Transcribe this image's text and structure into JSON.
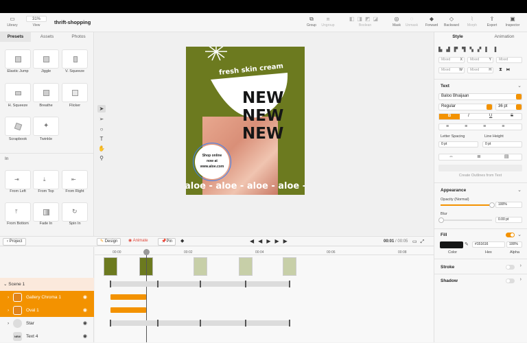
{
  "toolbar": {
    "library": "Library",
    "zoom": "31%",
    "view": "View",
    "doc_title": "thrift-shopping",
    "group": "Group",
    "ungroup": "Ungroup",
    "boolean": "Boolean",
    "mask": "Mask",
    "unmask": "Unmask",
    "forward": "Forward",
    "backward": "Backward",
    "morph": "Morph",
    "export": "Export",
    "inspector": "Inspector"
  },
  "left_tabs": [
    "Presets",
    "Assets",
    "Photos"
  ],
  "presets": [
    "Elastic Jump",
    "Jiggle",
    "V. Squeeze",
    "H. Squeeze",
    "Breathe",
    "Flicker",
    "Scrapbook",
    "Twinkle"
  ],
  "in_section": "In",
  "in_presets": [
    "From Left",
    "From Top",
    "From Right",
    "From Bottom",
    "Fade In",
    "Spin In"
  ],
  "project_button": "Project",
  "artboard": {
    "headline": "fresh skin cream",
    "new_lines": [
      "NEW",
      "NEW",
      "NEW"
    ],
    "badge_lines": [
      "Shop online",
      "now at",
      "www.aloe.com"
    ],
    "marquee": "aloe - aloe - aloe - aloe -al"
  },
  "timeline": {
    "design": "Design",
    "animate": "Animate",
    "pin": "Pin",
    "time_current": "00:01",
    "time_total": "/ 00:05",
    "ticks": [
      "00:00",
      "00:02",
      "00:04",
      "00:06",
      "00:08"
    ]
  },
  "layers": {
    "scene": "Scene 1",
    "items": [
      "Gallery Chroma 1",
      "Oval 1",
      "Star",
      "Text 4"
    ]
  },
  "inspector": {
    "tabs": [
      "Style",
      "Animation"
    ],
    "mixed": [
      "Mixed",
      "Mixed",
      "Mixed",
      "Mixed",
      "Mixed"
    ],
    "axis": [
      "X",
      "Y",
      "W",
      "H"
    ],
    "text_title": "Text",
    "font": "Baloo Bhaijaan",
    "weight": "Regular",
    "size": "36 pt",
    "letter_spacing_label": "Letter Spacing",
    "line_height_label": "Line Height",
    "letter_spacing": "0 pt",
    "line_height": "0 pt",
    "outlines": "Create Outlines from Text",
    "appearance_title": "Appearance",
    "opacity_label": "Opacity (Normal)",
    "opacity": "100%",
    "opacity_level": 1.0,
    "blur_label": "Blur",
    "blur": "0.00 pt",
    "fill_title": "Fill",
    "fill_hex": "#151616",
    "fill_alpha": "100%",
    "color_label": "Color",
    "hex_label": "Hex",
    "alpha_label": "Alpha",
    "stroke_title": "Stroke",
    "shadow_title": "Shadow"
  },
  "colors": {
    "accent": "#f39200",
    "artboard_bg": "#6c7a1f",
    "fill": "#151616"
  }
}
